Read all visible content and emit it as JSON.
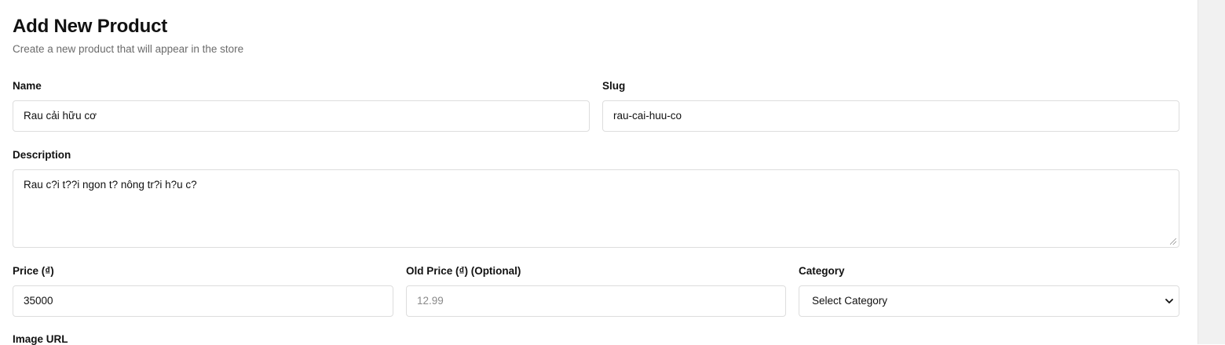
{
  "header": {
    "title": "Add New Product",
    "subtitle": "Create a new product that will appear in the store"
  },
  "form": {
    "name": {
      "label": "Name",
      "value": "Rau cải hữu cơ"
    },
    "slug": {
      "label": "Slug",
      "value": "rau-cai-huu-co"
    },
    "description": {
      "label": "Description",
      "value": "Rau c?i t??i ngon t? nông tr?i h?u c?"
    },
    "price": {
      "label": "Price (₫)",
      "value": "35000"
    },
    "old_price": {
      "label": "Old Price (₫) (Optional)",
      "placeholder": "12.99"
    },
    "category": {
      "label": "Category",
      "selected": "Select Category"
    },
    "image_url": {
      "label": "Image URL"
    }
  }
}
